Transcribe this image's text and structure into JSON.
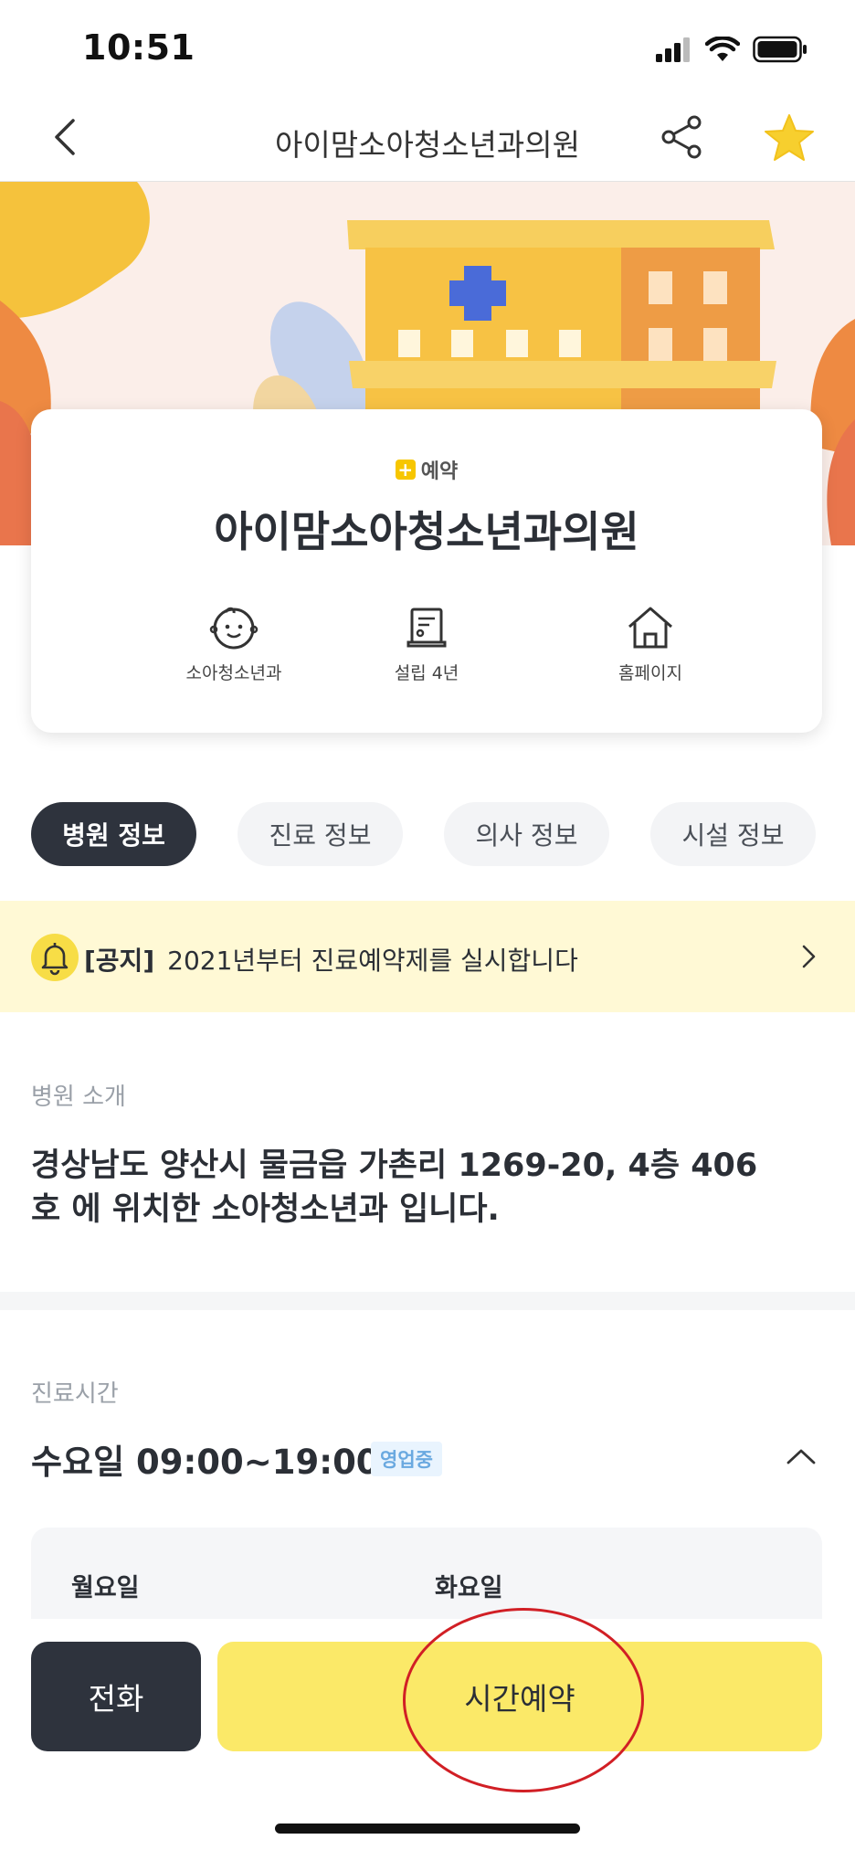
{
  "status": {
    "time": "10:51"
  },
  "nav": {
    "title": "아이맘소아청소년과의원"
  },
  "card": {
    "badge": "예약",
    "title": "아이맘소아청소년과의원",
    "features": [
      {
        "label": "소아청소년과",
        "icon": "baby-face-icon"
      },
      {
        "label": "설립 4년",
        "icon": "certificate-icon"
      },
      {
        "label": "홈페이지",
        "icon": "home-icon"
      }
    ]
  },
  "tabs": [
    "병원 정보",
    "진료 정보",
    "의사 정보",
    "시설 정보"
  ],
  "notice": {
    "tag": "[공지]",
    "text": "2021년부터 진료예약제를 실시합니다"
  },
  "intro": {
    "label": "병원 소개",
    "text": "경상남도 양산시 물금읍 가촌리 1269-20, 4층 406호 에 위치한 소아청소년과 입니다."
  },
  "hours": {
    "label": "진료시간",
    "today": "수요일 09:00~19:00",
    "status": "영업중",
    "days": [
      "월요일",
      "화요일"
    ]
  },
  "actions": {
    "call": "전화",
    "book": "시간예약"
  },
  "colors": {
    "accent_yellow": "#fbe968",
    "dark": "#2e333d",
    "notice_bg": "#fff9d5"
  }
}
